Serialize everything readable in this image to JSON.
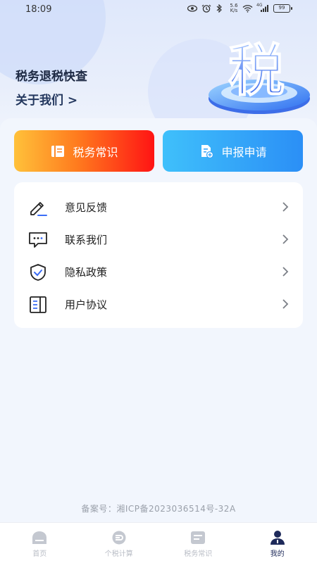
{
  "status_bar": {
    "time": "18:09",
    "net_speed_value": "5.6",
    "net_speed_unit": "K/s",
    "network_type": "4G",
    "battery": "99"
  },
  "header": {
    "app_title": "税务退税快查",
    "about_link": "关于我们 >",
    "art_char": "税"
  },
  "actions": {
    "tax_knowledge_label": "税务常识",
    "apply_label": "申报申请"
  },
  "menu": {
    "items": [
      {
        "label": "意见反馈",
        "icon": "edit-pen-icon"
      },
      {
        "label": "联系我们",
        "icon": "chat-bubble-icon"
      },
      {
        "label": "隐私政策",
        "icon": "shield-check-icon"
      },
      {
        "label": "用户协议",
        "icon": "document-icon"
      }
    ]
  },
  "footer": {
    "icp": "备案号：湘ICP备2023036514号-32A"
  },
  "tabbar": {
    "tabs": [
      {
        "label": "首页",
        "icon": "home-icon",
        "active": false
      },
      {
        "label": "个税计算",
        "icon": "calculator-icon",
        "active": false
      },
      {
        "label": "税务常识",
        "icon": "notebook-icon",
        "active": false
      },
      {
        "label": "我的",
        "icon": "user-icon",
        "active": true
      }
    ]
  },
  "colors": {
    "active_tab": "#1e2a5a",
    "inactive_tab": "#b9bdc6",
    "orange_start": "#ffc13a",
    "red_end": "#ff1414",
    "blue_start": "#3fc0fb",
    "blue_end": "#2b8ff6"
  }
}
